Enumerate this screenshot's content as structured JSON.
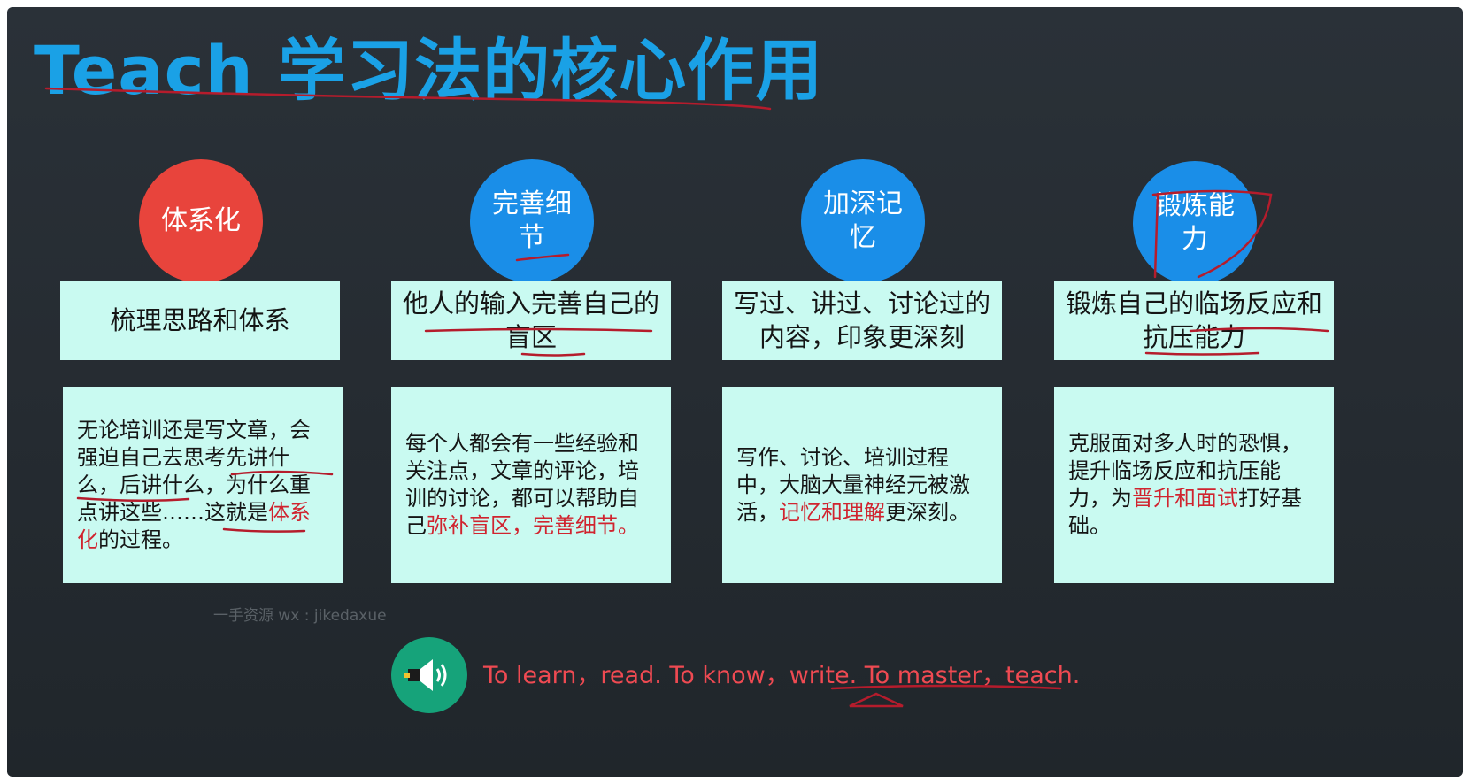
{
  "title": "Teach 学习法的核心作用",
  "colors": {
    "title": "#1aa1e6",
    "red_circle": "#e8443c",
    "blue_circle": "#1a8ee8",
    "box": "#c9faf1",
    "highlight": "#d0242f",
    "speaker": "#16a37a"
  },
  "columns": [
    {
      "circle": "体系化",
      "heading": "梳理思路和体系",
      "body": [
        {
          "text": "无论培训还是写文章，会强迫自己去思考先讲什么，后讲什么，为什么重点讲这些……这就是"
        },
        {
          "text": "体系化",
          "highlight": true
        },
        {
          "text": "的过程。"
        }
      ]
    },
    {
      "circle": "完善细节",
      "heading": "他人的输入完善自己的盲区",
      "body": [
        {
          "text": "每个人都会有一些经验和关注点，文章的评论，培训的讨论，都可以帮助自己"
        },
        {
          "text": "弥补盲区，完善细节。",
          "highlight": true
        }
      ]
    },
    {
      "circle": "加深记忆",
      "heading": "写过、讲过、讨论过的内容，印象更深刻",
      "body": [
        {
          "text": "写作、讨论、培训过程中，大脑大量神经元被激活，"
        },
        {
          "text": "记忆和理解",
          "highlight": true
        },
        {
          "text": "更深刻。"
        }
      ]
    },
    {
      "circle": "锻炼能力",
      "heading": "锻炼自己的临场反应和抗压能力",
      "body": [
        {
          "text": "克服面对多人时的恐惧，提升临场反应和抗压能力，为"
        },
        {
          "text": "晋升和面试",
          "highlight": true
        },
        {
          "text": "打好基础。"
        }
      ]
    }
  ],
  "watermark": "一手资源 wx : jikedaxue",
  "speaker_icon": "speaker-icon",
  "quote": "To learn，read. To know，write. To master，teach."
}
